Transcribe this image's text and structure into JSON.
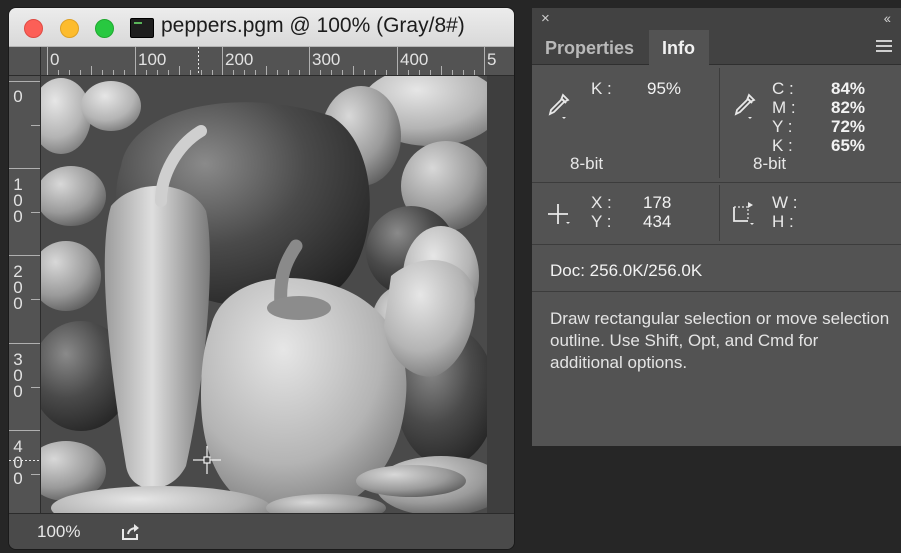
{
  "document": {
    "title": "peppers.pgm @ 100% (Gray/8#)",
    "zoom": "100%",
    "ruler_h_labels": [
      "0",
      "100",
      "200",
      "300",
      "400",
      "5"
    ],
    "ruler_v_labels": [
      "0",
      "1\n0\n0",
      "2\n0\n0",
      "3\n0\n0",
      "4\n0\n0"
    ]
  },
  "panel": {
    "close": "×",
    "collapse": "‹‹",
    "tabs": [
      {
        "label": "Properties",
        "active": false
      },
      {
        "label": "Info",
        "active": true
      }
    ],
    "gray_k_label": "K :",
    "gray_k_value": "95%",
    "gray_bitdepth": "8-bit",
    "cmyk_labels": [
      "C :",
      "M :",
      "Y :",
      "K :"
    ],
    "cmyk_values": [
      "84%",
      "82%",
      "72%",
      "65%"
    ],
    "cmyk_bitdepth": "8-bit",
    "x_label": "X :",
    "x_value": "178",
    "y_label": "Y :",
    "y_value": "434",
    "w_label": "W :",
    "h_label": "H :",
    "doc_size": "Doc: 256.0K/256.0K",
    "help_text": "Draw rectangular selection or move selection outline.  Use Shift, Opt, and Cmd for additional options."
  },
  "icons": [
    "eyedropper-icon",
    "crosshair-icon",
    "selection-size-icon",
    "share-icon",
    "panel-menu-icon"
  ],
  "colors": {
    "panel_bg": "#535353",
    "tab_bar": "#424242",
    "desktop": "#262626"
  }
}
